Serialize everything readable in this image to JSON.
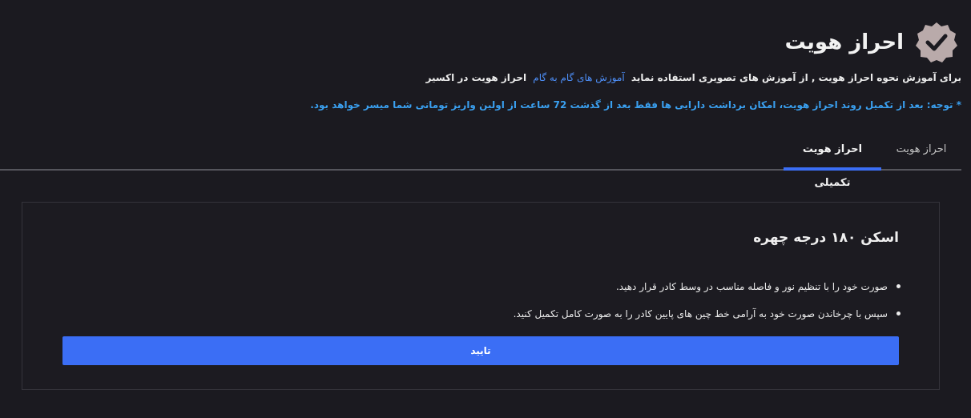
{
  "header": {
    "title": "احراز هویت",
    "icon": "verified-badge-icon",
    "icon_color": "#b9aaaa"
  },
  "intro": {
    "text": "برای آموزش نحوه احراز هویت , از آموزش های تصویری استفاده نماید",
    "link_label": "آموزش های گام به گام",
    "suffix": "احراز هویت در اکسیر"
  },
  "notice": "* توجه: بعد از تکمیل روند احراز هویت، امکان برداشت دارایی ها فقط بعد از گذشت 72 ساعت از اولین واریز تومانی شما میسر خواهد بود.",
  "tabs": [
    {
      "label": "احراز هویت",
      "active": false
    },
    {
      "label": "احراز هویت تکمیلی",
      "active": true
    }
  ],
  "card": {
    "title": "اسکن ۱۸۰ درجه چهره",
    "steps": [
      "صورت خود را با تنظیم نور و فاصله مناسب در وسط کادر قرار دهید.",
      "سپس با چرخاندن صورت خود به آرامی خط چین های پایین کادر را به صورت کامل تکمیل کنید."
    ],
    "confirm_label": "تایید"
  },
  "colors": {
    "background": "#1b1a20",
    "accent": "#3b6ef5",
    "link": "#4d8ef7",
    "notice": "#3aa0f0"
  }
}
